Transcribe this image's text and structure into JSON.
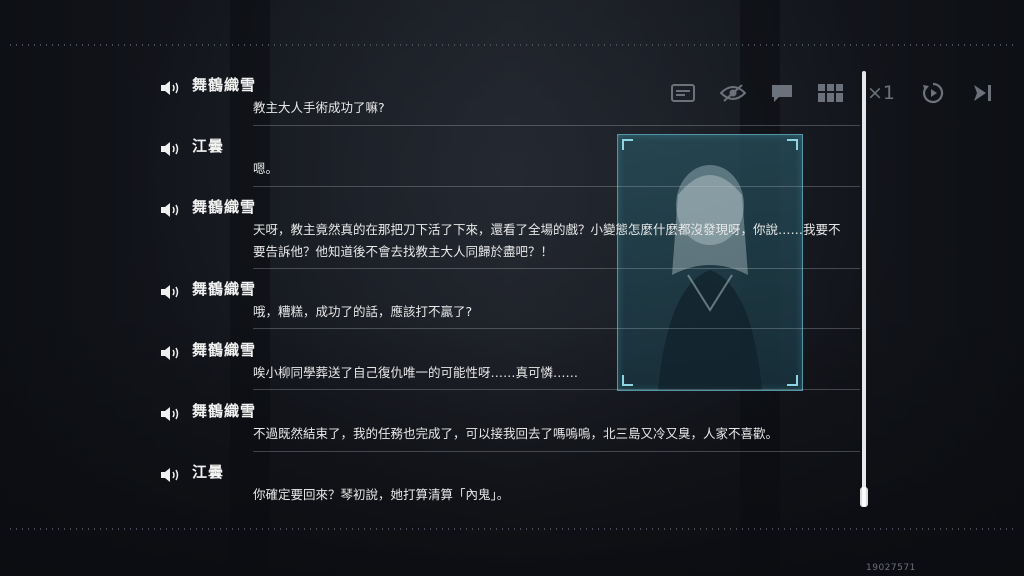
{
  "toolbar": {
    "buttons": [
      {
        "name": "dialog-log-icon"
      },
      {
        "name": "hide-ui-icon"
      },
      {
        "name": "chat-bubble-icon"
      },
      {
        "name": "gallery-grid-icon"
      },
      {
        "name": "speed-toggle",
        "label": "×1"
      },
      {
        "name": "auto-play-icon"
      },
      {
        "name": "skip-icon"
      }
    ]
  },
  "log": {
    "entries": [
      {
        "speaker": "舞鶴織雪",
        "text": "教主大人手術成功了嘛?"
      },
      {
        "speaker": "江曇",
        "text": "嗯。"
      },
      {
        "speaker": "舞鶴織雪",
        "text": "天呀，教主竟然真的在那把刀下活了下來，還看了全場的戲？小變態怎麼什麼都沒發現呀，你說……我要不要告訴他？他知道後不會去找教主大人同歸於盡吧？！"
      },
      {
        "speaker": "舞鶴織雪",
        "text": "哦，糟糕，成功了的話，應該打不贏了?"
      },
      {
        "speaker": "舞鶴織雪",
        "text": "唉小柳同學葬送了自己復仇唯一的可能性呀……真可憐……"
      },
      {
        "speaker": "舞鶴織雪",
        "text": "不過既然結束了，我的任務也完成了，可以接我回去了嗎嗚嗚，北三島又冷又臭，人家不喜歡。"
      },
      {
        "speaker": "江曇",
        "text": "你確定要回來？琴初說，她打算清算「內鬼」。"
      }
    ]
  },
  "build_number": "19027571",
  "colors": {
    "portrait_frame": "#4f95a6",
    "text": "#e8e8e8",
    "toolbar_icon": "#6c727b"
  }
}
